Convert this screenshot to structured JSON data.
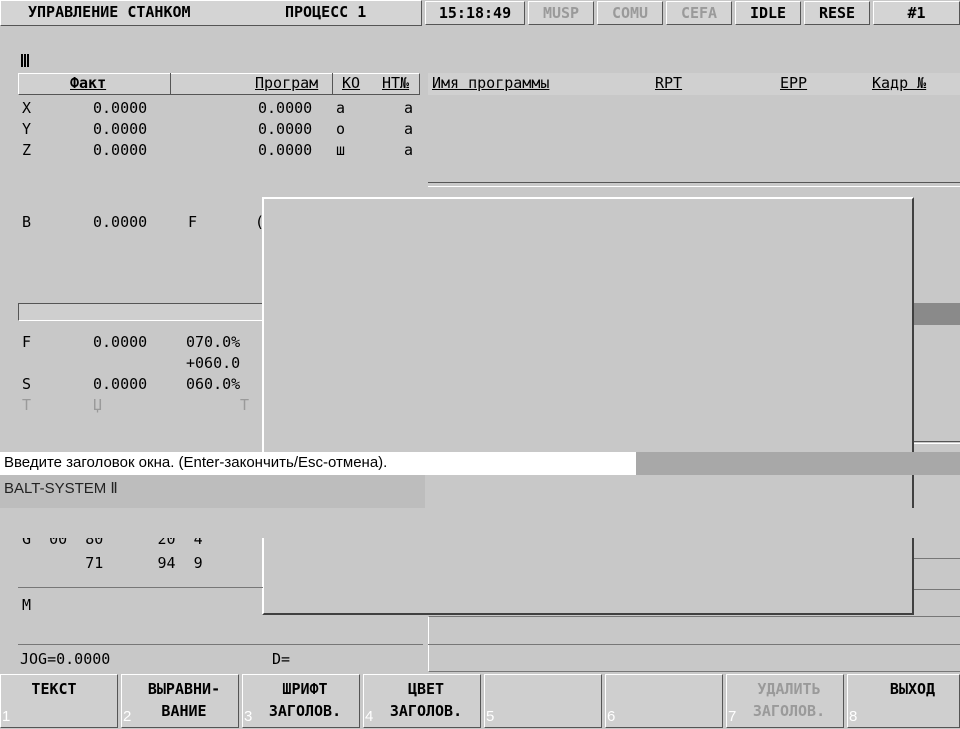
{
  "header": {
    "title": "УПРАВЛЕНИЕ СТАНКОМ",
    "process": "ПРОЦЕСС 1",
    "time": "15:18:49",
    "status_musp": "MUSP",
    "status_comu": "COMU",
    "status_cefa": "CEFA",
    "status_idle": "IDLE",
    "status_rese": "RESE",
    "channel": "#1"
  },
  "columns": {
    "fact": "Факт",
    "program": "Програм",
    "ko": "КО",
    "ntn": "НТ№",
    "program_name": "Имя программы",
    "rpt": "RPT",
    "epp": "EPP",
    "frame_no": "Кадр №"
  },
  "axes": [
    {
      "name": "X",
      "fact": "0.0000",
      "prog": "0.0000",
      "ko": "a",
      "ntn": "a"
    },
    {
      "name": "Y",
      "fact": "0.0000",
      "prog": "0.0000",
      "ko": "o",
      "ntn": "a"
    },
    {
      "name": "Z",
      "fact": "0.0000",
      "prog": "0.0000",
      "ko": "ш",
      "ntn": "a"
    },
    {
      "name": "B",
      "fact": "0.0000",
      "extra": "F",
      "prog": "("
    }
  ],
  "feed": {
    "f_label": "F",
    "f_value": "0.0000",
    "f_pct": "070.0%",
    "f_offset": "+060.0",
    "s_label": "S",
    "s_value": "0.0000",
    "s_pct": "060.0%",
    "t_label": "T",
    "t_mid": "Џ",
    "t_right": "T"
  },
  "g_codes": {
    "row1": "G  00  80      20  4",
    "row2": "       71      94  9"
  },
  "m_label": "M",
  "jog": {
    "label": "JOG=0.0000",
    "d_label": "D="
  },
  "prompt": {
    "text": "Введите заголовок окна. (Enter-закончить/Esc-отмена).",
    "input_value": "BALT-SYSTEM Ⅱ"
  },
  "function_keys": [
    {
      "num": "1",
      "label": "ТЕКСТ",
      "enabled": true
    },
    {
      "num": "2",
      "label": "ВЫРАВНИ-\nВАНИЕ",
      "enabled": true
    },
    {
      "num": "3",
      "label": "ШРИФТ\nЗАГОЛОВ.",
      "enabled": true
    },
    {
      "num": "4",
      "label": "ЦВЕТ\nЗАГОЛОВ.",
      "enabled": true
    },
    {
      "num": "5",
      "label": "",
      "enabled": true
    },
    {
      "num": "6",
      "label": "",
      "enabled": true
    },
    {
      "num": "7",
      "label": "УДАЛИТЬ\nЗАГОЛОВ.",
      "enabled": false
    },
    {
      "num": "8",
      "label": "ВЫХОД",
      "enabled": true
    }
  ],
  "colors": {
    "background": "#c8c8c8",
    "prompt_bg": "#ffffff",
    "input_bg": "#bdbdbd",
    "disabled_text": "#9a9a9a"
  }
}
